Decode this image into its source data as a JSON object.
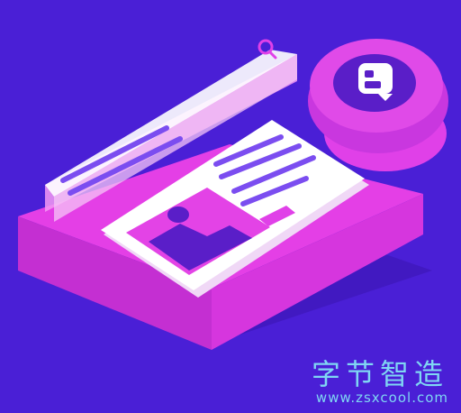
{
  "illustration": {
    "description_icons": [
      "search-icon",
      "blogger-b-icon",
      "image-placeholder-icon"
    ],
    "colors": {
      "background": "#4a1fd6",
      "magenta": "#e040e8",
      "magenta_dark": "#c030c0",
      "panel_white": "#ffffff",
      "accent_purple": "#7b4df0",
      "dark_purple": "#5a1ec8"
    }
  },
  "watermark": {
    "title": "字节智造",
    "url": "www.zsxcool.com"
  }
}
